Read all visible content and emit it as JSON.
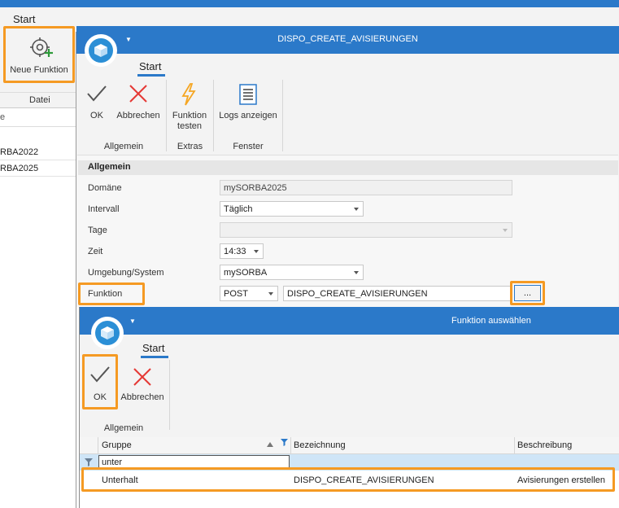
{
  "background_app": {
    "tab_start": "Start",
    "new_function_label": "Neue Funktion",
    "column_datei": "Datei",
    "column_partial": "e",
    "rows": [
      "RBA2022",
      "RBA2025"
    ]
  },
  "dialog1": {
    "title": "DISPO_CREATE_AVISIERUNGEN",
    "tab_start": "Start",
    "buttons": {
      "ok": "OK",
      "cancel": "Abbrechen",
      "test_line1": "Funktion",
      "test_line2": "testen",
      "logs": "Logs anzeigen"
    },
    "groups": {
      "general": "Allgemein",
      "extras": "Extras",
      "window": "Fenster"
    },
    "section_title": "Allgemein",
    "form": {
      "domain_label": "Domäne",
      "domain_value": "mySORBA2025",
      "interval_label": "Intervall",
      "interval_value": "Täglich",
      "days_label": "Tage",
      "days_value": "",
      "time_label": "Zeit",
      "time_value": "14:33",
      "env_label": "Umgebung/System",
      "env_value": "mySORBA",
      "function_label": "Funktion",
      "method_value": "POST",
      "function_value": "DISPO_CREATE_AVISIERUNGEN",
      "browse_label": "..."
    }
  },
  "dialog2": {
    "title": "Funktion auswählen",
    "tab_start": "Start",
    "buttons": {
      "ok": "OK",
      "cancel": "Abbrechen"
    },
    "group_general": "Allgemein",
    "grid": {
      "headers": {
        "group": "Gruppe",
        "name": "Bezeichnung",
        "description": "Beschreibung"
      },
      "filter_value": "unter",
      "rows": [
        {
          "group": "Unterhalt",
          "name": "DISPO_CREATE_AVISIERUNGEN",
          "description": "Avisierungen erstellen"
        }
      ]
    }
  },
  "colors": {
    "accent": "#2b79c9",
    "highlight": "#f59a23",
    "cancel_red": "#e53935",
    "lightning_orange": "#f5a623"
  }
}
